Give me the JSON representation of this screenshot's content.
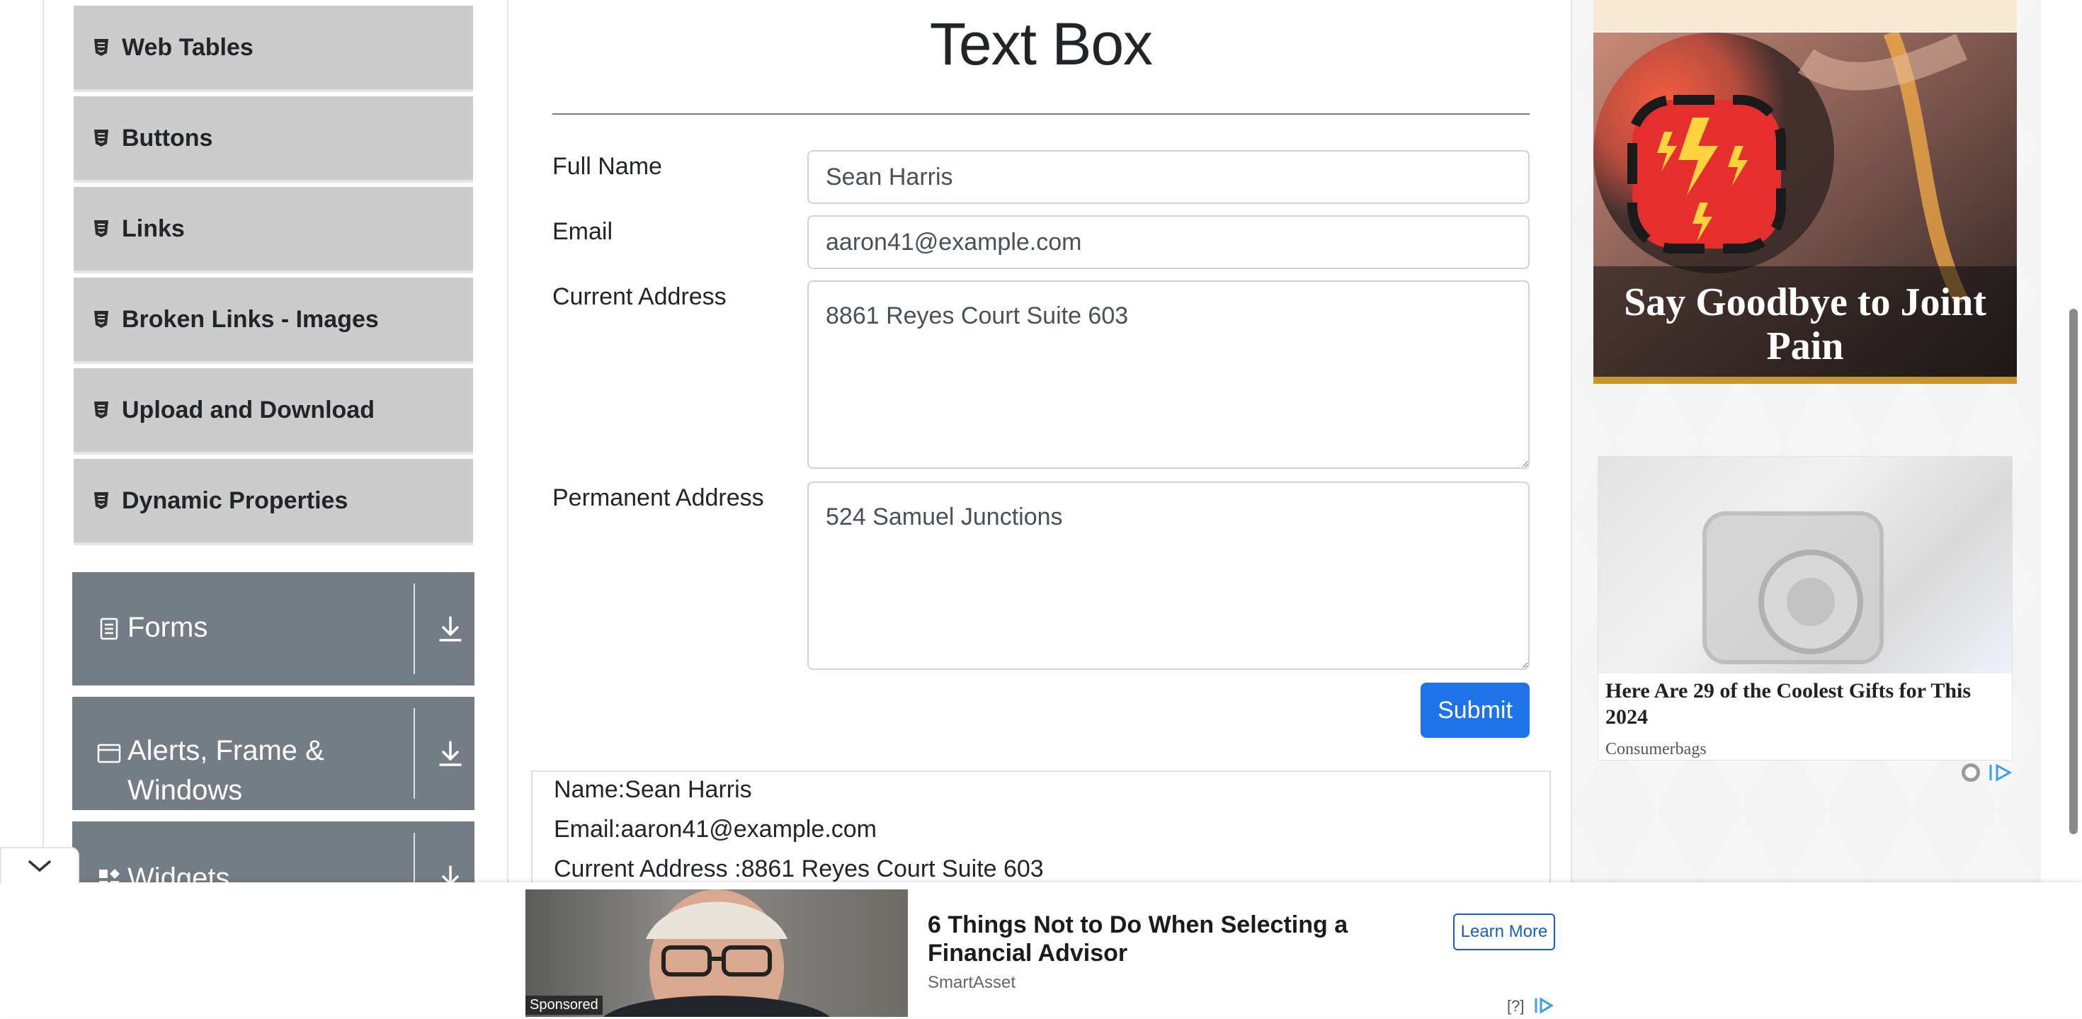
{
  "sidebar": {
    "items": [
      {
        "label": "Web Tables",
        "icon": "html5-icon"
      },
      {
        "label": "Buttons",
        "icon": "html5-icon"
      },
      {
        "label": "Links",
        "icon": "html5-icon"
      },
      {
        "label": "Broken Links - Images",
        "icon": "html5-icon"
      },
      {
        "label": "Upload and Download",
        "icon": "html5-icon"
      },
      {
        "label": "Dynamic Properties",
        "icon": "html5-icon"
      }
    ],
    "groups": [
      {
        "label": "Forms",
        "icon": "form-icon"
      },
      {
        "label_line1": "Alerts, Frame &",
        "label_line2": "Windows",
        "icon": "window-icon"
      },
      {
        "label": "Widgets",
        "icon": "widgets-icon"
      }
    ]
  },
  "main": {
    "title": "Text Box",
    "fields": {
      "full_name": {
        "label": "Full Name",
        "value": "Sean Harris"
      },
      "email": {
        "label": "Email",
        "value": "aaron41@example.com"
      },
      "current_address": {
        "label": "Current Address",
        "value": "8861 Reyes Court Suite 603"
      },
      "permanent_address": {
        "label": "Permanent Address",
        "value": "524 Samuel Junctions"
      }
    },
    "submit_label": "Submit",
    "output": {
      "name": "Name:Sean Harris",
      "email": "Email:aaron41@example.com",
      "current_address": "Current Address :8861 Reyes Court Suite 603"
    }
  },
  "ads": {
    "joint_pain": {
      "caption": "Say Goodbye to Joint Pain"
    },
    "gifts": {
      "title": "Here Are 29 of the Coolest Gifts for This 2024",
      "source": "Consumerbags"
    },
    "bottom": {
      "title": "6 Things Not to Do When Selecting a Financial Advisor",
      "source": "SmartAsset",
      "sponsored": "Sponsored",
      "cta": "Learn More",
      "help": "[?]"
    }
  },
  "colors": {
    "submit": "#1f73e8",
    "group_bg": "#747c85",
    "menu_item_bg": "#cccccc"
  }
}
